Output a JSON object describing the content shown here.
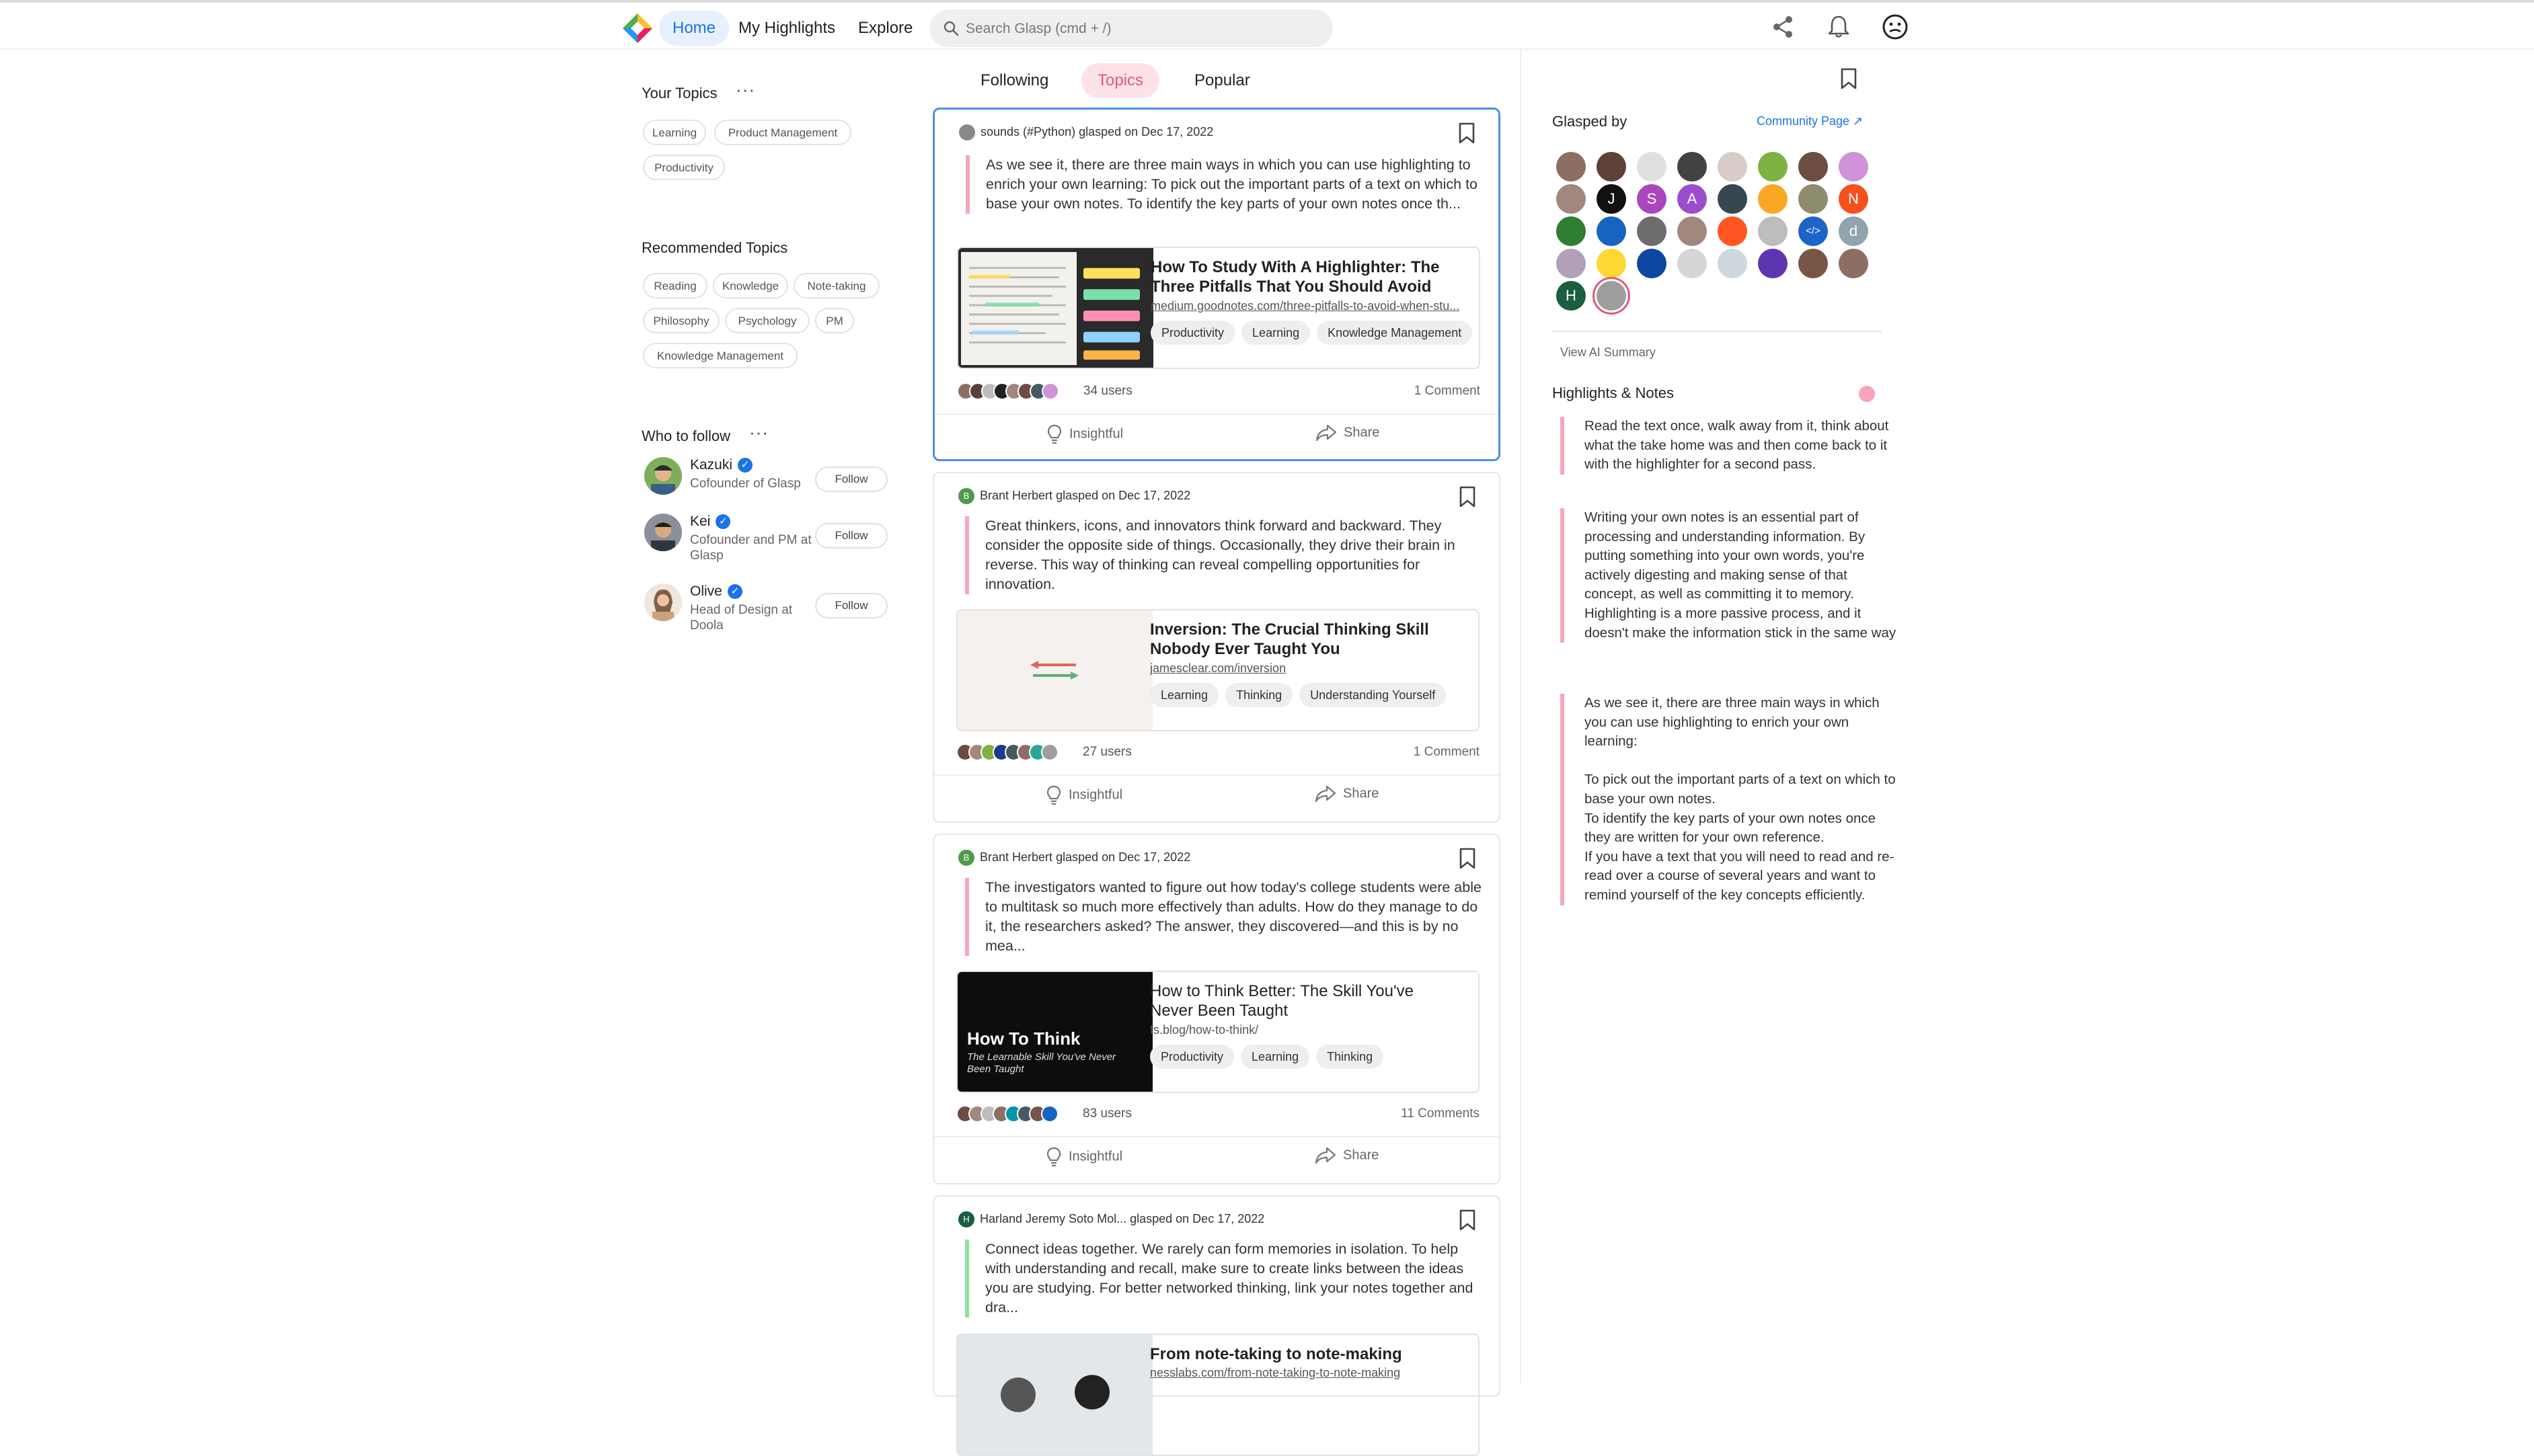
{
  "header": {
    "nav": [
      {
        "label": "Home",
        "active": true
      },
      {
        "label": "My Highlights",
        "active": false
      },
      {
        "label": "Explore",
        "active": false
      }
    ],
    "search_placeholder": "Search Glasp (cmd + /)"
  },
  "sidebar": {
    "your_topics_title": "Your Topics",
    "your_topics": [
      "Learning",
      "Product Management",
      "Productivity"
    ],
    "recommended_title": "Recommended Topics",
    "recommended": [
      "Reading",
      "Knowledge",
      "Note-taking",
      "Philosophy",
      "Psychology",
      "PM",
      "Knowledge Management"
    ],
    "who_to_follow_title": "Who to follow",
    "follow_label": "Follow",
    "people": [
      {
        "name": "Kazuki",
        "title": "Cofounder of Glasp"
      },
      {
        "name": "Kei",
        "title": "Cofounder and PM at Glasp"
      },
      {
        "name": "Olive",
        "title": "Head of Design at Doola"
      }
    ]
  },
  "feed": {
    "tabs": [
      {
        "label": "Following",
        "active": false
      },
      {
        "label": "Topics",
        "active": true
      },
      {
        "label": "Popular",
        "active": false
      }
    ],
    "insightful_label": "Insightful",
    "share_label": "Share",
    "cards": [
      {
        "user": "sounds (#Python)",
        "action": "glasped on Dec 17, 2022",
        "highlight": "As we see it, there are three main ways in which you can use highlighting to enrich your own learning: To pick out the important parts of a text on which to base your own notes. To identify the key parts of your own notes once th...",
        "article_title": "How To Study With A Highlighter: The Three Pitfalls That You Should Avoid",
        "article_url": "medium.goodnotes.com/three-pitfalls-to-avoid-when-stu...",
        "tags": [
          "Productivity",
          "Learning",
          "Knowledge Management"
        ],
        "users": "34 users",
        "comments": "1 Comment"
      },
      {
        "user": "Brant Herbert",
        "action": "glasped on Dec 17, 2022",
        "highlight": "Great thinkers, icons, and innovators think forward and backward. They consider the opposite side of things. Occasionally, they drive their brain in reverse. This way of thinking can reveal compelling opportunities for innovation.",
        "article_title": "Inversion: The Crucial Thinking Skill Nobody Ever Taught You",
        "article_url": "jamesclear.com/inversion",
        "tags": [
          "Learning",
          "Thinking",
          "Understanding Yourself"
        ],
        "users": "27 users",
        "comments": "1 Comment"
      },
      {
        "user": "Brant Herbert",
        "action": "glasped on Dec 17, 2022",
        "highlight": "The investigators wanted to figure out how today's college students were able to multitask so much more effectively than adults. How do they manage to do it, the researchers asked? The answer, they discovered—and this is by no mea...",
        "article_title": "How to Think Better: The Skill You've Never Been Taught",
        "article_url": "fs.blog/how-to-think/",
        "thumb_title": "How To Think",
        "thumb_subtitle": "The Learnable Skill You've Never Been Taught",
        "tags": [
          "Productivity",
          "Learning",
          "Thinking"
        ],
        "users": "83 users",
        "comments": "11 Comments"
      },
      {
        "user": "Harland Jeremy Soto Mol...",
        "action": "glasped on Dec 17, 2022",
        "highlight": "Connect ideas together. We rarely can form memories in isolation. To help with understanding and recall, make sure to create links between the ideas you are studying. For better networked thinking, link your notes together and dra...",
        "article_title": "From note-taking to note-making",
        "article_url": "nesslabs.com/from-note-taking-to-note-making"
      }
    ]
  },
  "right_panel": {
    "glasped_by_title": "Glasped by",
    "community_link": "Community Page ↗",
    "letter_avatars": {
      "j": "J",
      "s": "S",
      "a": "A",
      "n": "N",
      "d": "d",
      "h": "H",
      "code": "</>"
    },
    "view_ai_summary": "View AI Summary",
    "highlights_title": "Highlights & Notes",
    "highlights": [
      "Read the text once, walk away from it, think about what the take home was and then come back to it with the highlighter for a second pass.",
      "Writing your own notes is an essential part of processing and understanding information. By putting something into your own words, you're actively digesting and making sense of that concept, as well as committing it to memory. Highlighting is a more passive process, and it doesn't make the information stick in the same way",
      "As we see it, there are three main ways in which you can use highlighting to enrich your own learning:\n\nTo pick out the important parts of a text on which to base your own notes.\nTo identify the key parts of your own notes once they are written for your own reference.\nIf you have a text that you will need to read and re-read over a course of several years and want to remind yourself of the key concepts efficiently."
    ]
  },
  "colors": {
    "accent": "#1a73e8",
    "topics_tab": "#e05a76",
    "highlight_bar": "#f4a7b9",
    "highlight_bar_green": "#8fe0a0",
    "selected_border": "#4a90e2"
  },
  "icons": [
    "search-icon",
    "share-icon",
    "bell-icon",
    "profile-icon",
    "bookmark-icon",
    "lightbulb-icon",
    "more-icon",
    "verified-icon"
  ]
}
